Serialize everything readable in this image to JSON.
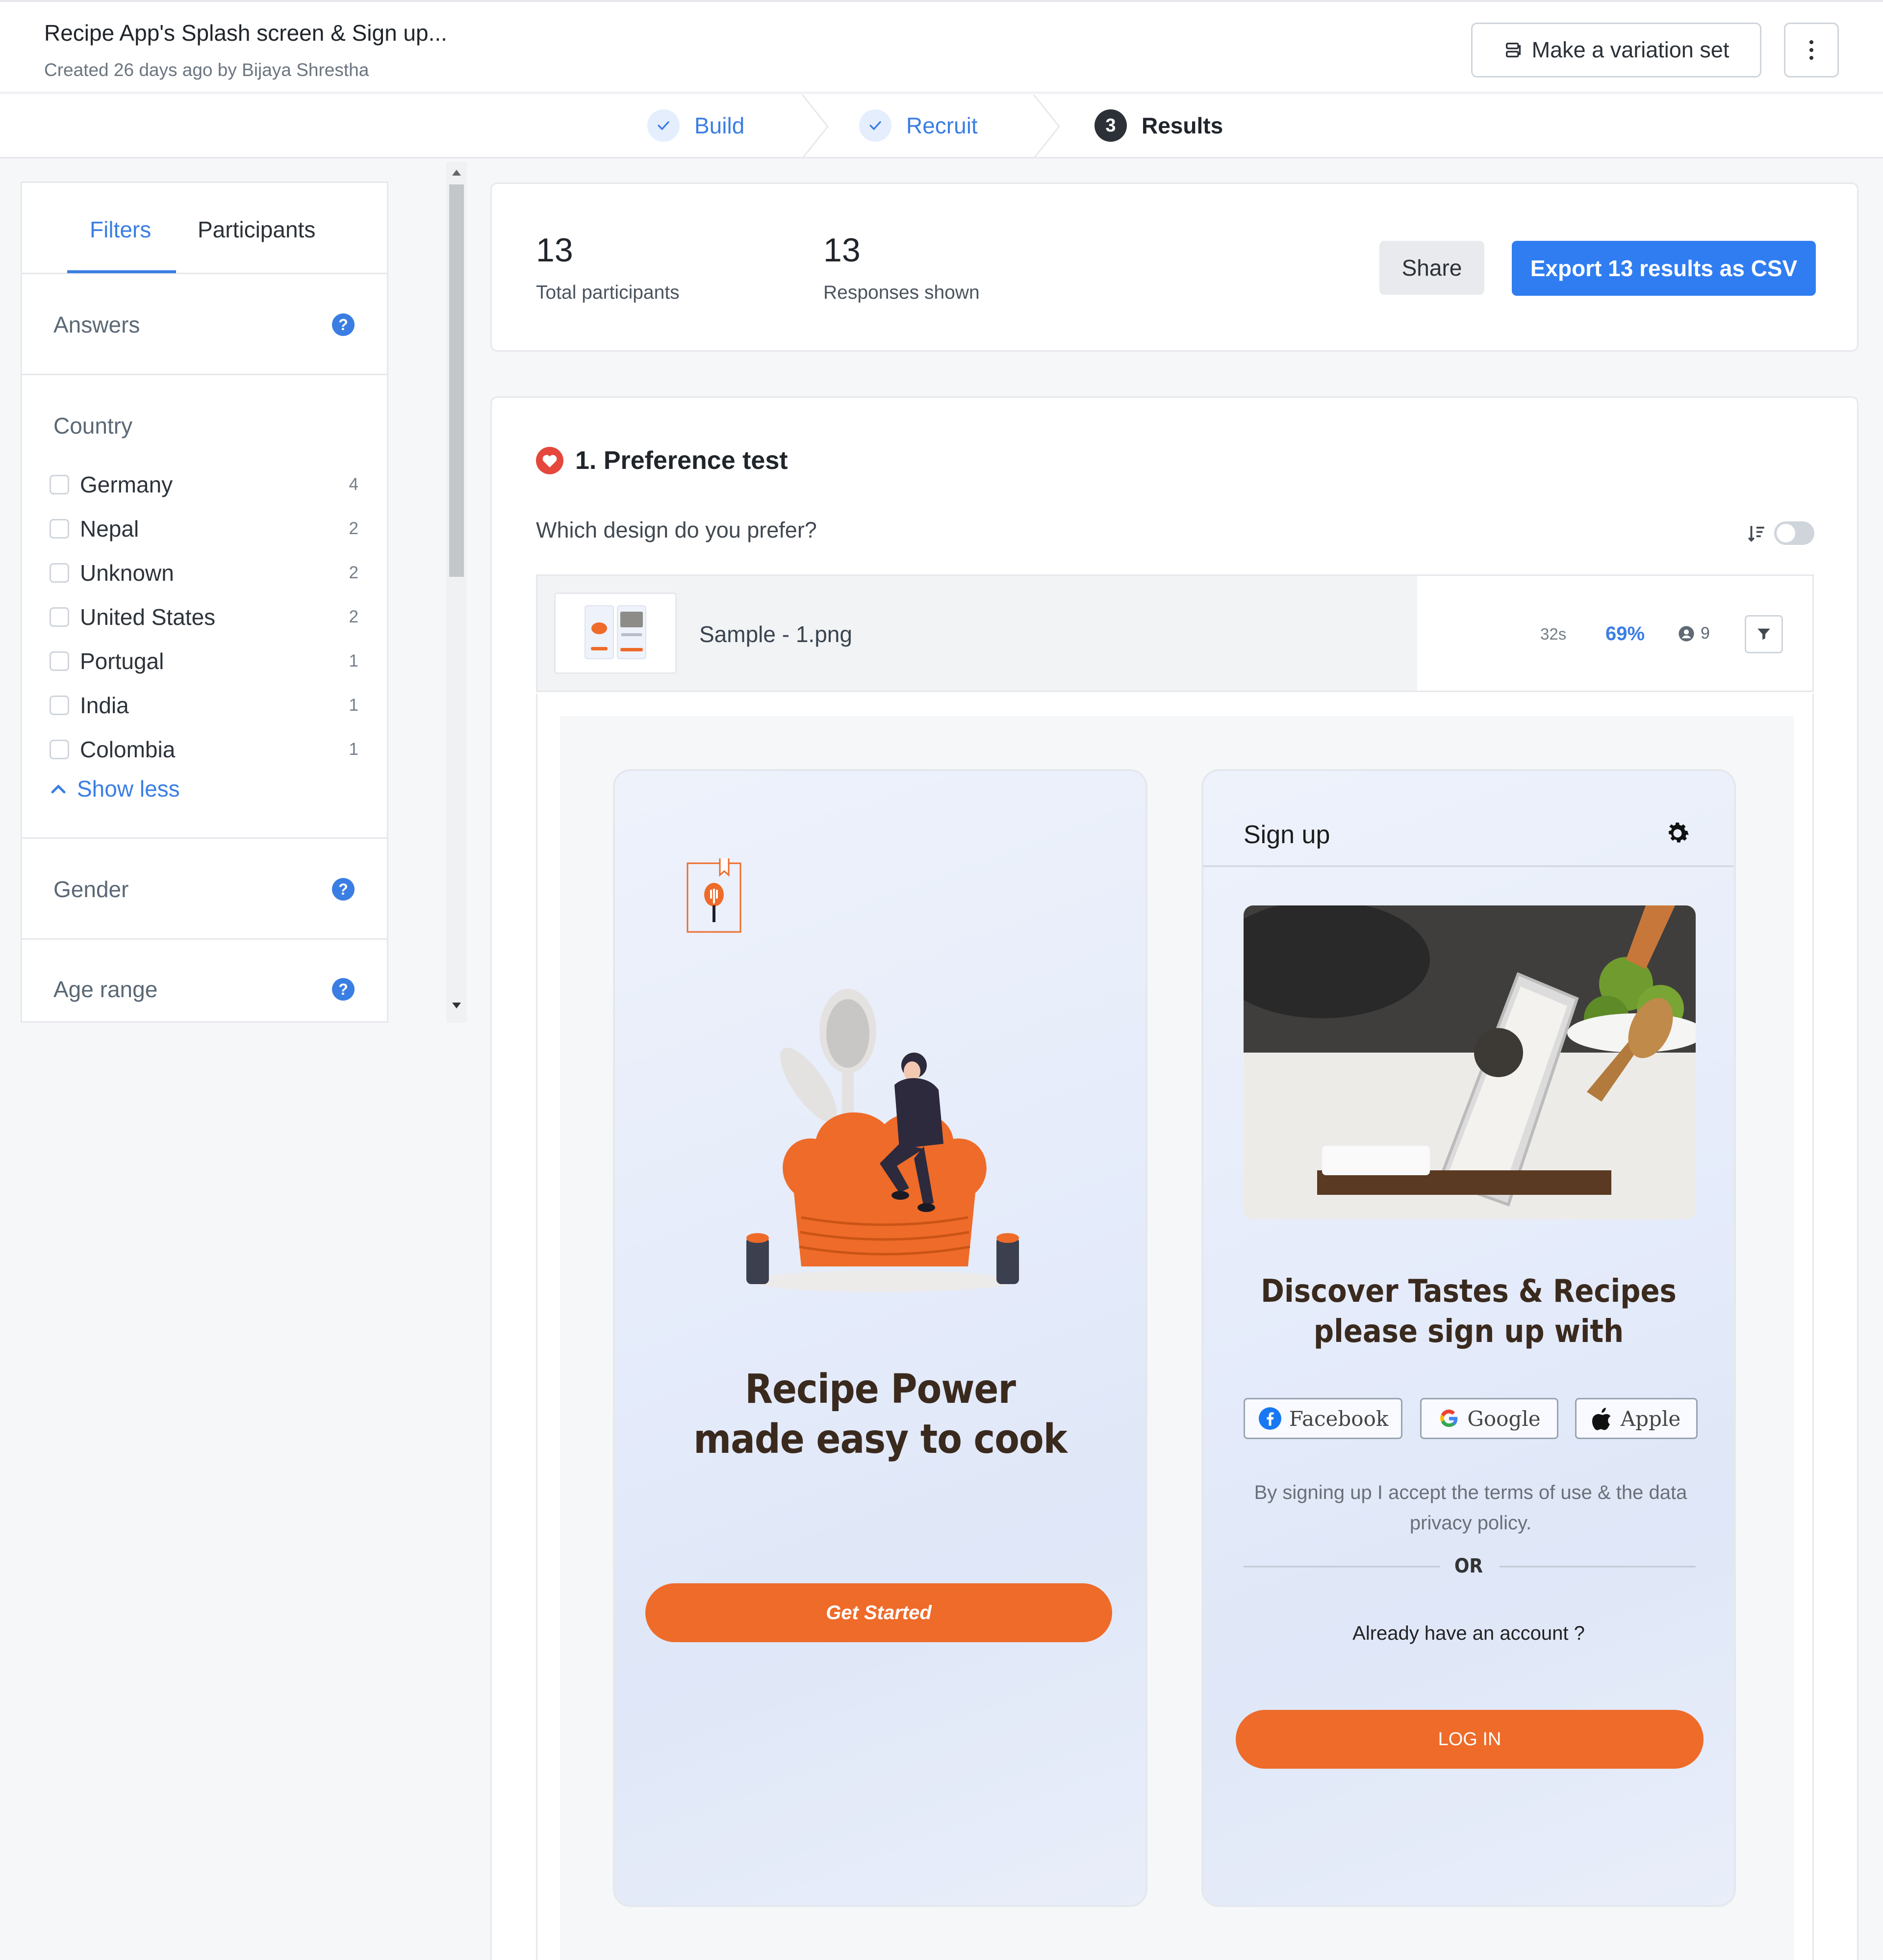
{
  "header": {
    "title": "Recipe App's Splash screen & Sign up...",
    "subtitle": "Created 26 days ago by Bijaya Shrestha",
    "variation_label": "Make a variation set"
  },
  "stepper": {
    "steps": [
      {
        "label": "Build",
        "state": "done"
      },
      {
        "label": "Recruit",
        "state": "done"
      },
      {
        "label": "Results",
        "state": "current",
        "number": "3"
      }
    ]
  },
  "sidebar": {
    "tabs": {
      "filters": "Filters",
      "participants": "Participants"
    },
    "answers_label": "Answers",
    "country_label": "Country",
    "countries": [
      {
        "name": "Germany",
        "count": "4"
      },
      {
        "name": "Nepal",
        "count": "2"
      },
      {
        "name": "Unknown",
        "count": "2"
      },
      {
        "name": "United States",
        "count": "2"
      },
      {
        "name": "Portugal",
        "count": "1"
      },
      {
        "name": "India",
        "count": "1"
      },
      {
        "name": "Colombia",
        "count": "1"
      }
    ],
    "show_less": "Show less",
    "gender_label": "Gender",
    "age_label": "Age range",
    "help_glyph": "?"
  },
  "summary": {
    "total_participants": "13",
    "total_label": "Total participants",
    "responses_shown": "13",
    "responses_label": "Responses shown",
    "share_label": "Share",
    "export_label": "Export 13 results as CSV"
  },
  "question": {
    "title": "1. Preference test",
    "prompt": "Which design do you prefer?",
    "option": {
      "name": "Sample - 1.png",
      "time": "32s",
      "percent": "69%",
      "count": "9",
      "share_fraction": 0.69
    }
  },
  "preview": {
    "splash": {
      "title_line1": "Recipe Power",
      "title_line2": "made easy to cook",
      "cta": "Get Started"
    },
    "signup": {
      "header": "Sign up",
      "headline_line1": "Discover Tastes & Recipes",
      "headline_line2": "please sign up with",
      "social": [
        "Facebook",
        "Google",
        "Apple"
      ],
      "terms": "By signing up I accept the terms of use & the data privacy policy.",
      "or": "OR",
      "already": "Already have an account ?",
      "login": "LOG IN"
    }
  },
  "colors": {
    "accent": "#3a7ee3",
    "primary_button": "#2f7df1",
    "brand_orange": "#ee6b2a",
    "heart_red": "#e5473c"
  }
}
